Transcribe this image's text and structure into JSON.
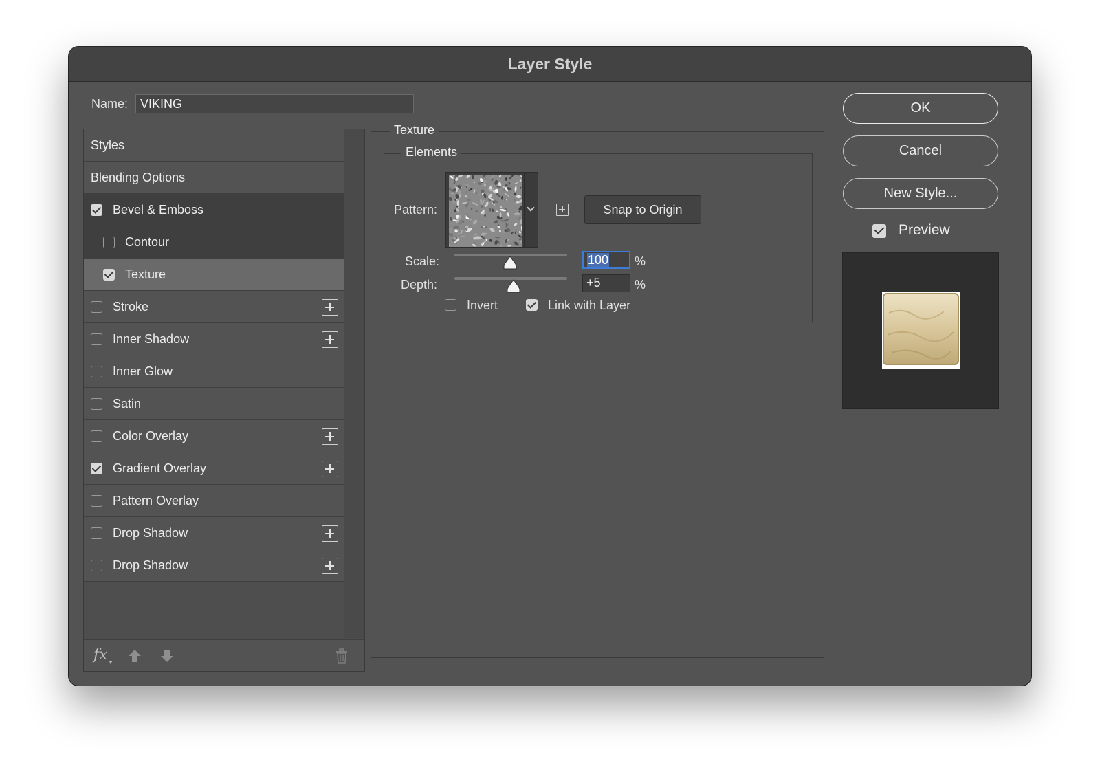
{
  "dialog": {
    "title": "Layer Style"
  },
  "name_field": {
    "label": "Name:",
    "value": "VIKING"
  },
  "styles_list": [
    {
      "label": "Styles",
      "type": "header"
    },
    {
      "label": "Blending Options",
      "type": "header"
    },
    {
      "label": "Bevel & Emboss",
      "checked": true,
      "state": "active-parent"
    },
    {
      "label": "Contour",
      "checked": false,
      "sub": true
    },
    {
      "label": "Texture",
      "checked": true,
      "sub": true,
      "selected": true
    },
    {
      "label": "Stroke",
      "checked": false,
      "add": true
    },
    {
      "label": "Inner Shadow",
      "checked": false,
      "add": true
    },
    {
      "label": "Inner Glow",
      "checked": false
    },
    {
      "label": "Satin",
      "checked": false
    },
    {
      "label": "Color Overlay",
      "checked": false,
      "add": true
    },
    {
      "label": "Gradient Overlay",
      "checked": true,
      "add": true
    },
    {
      "label": "Pattern Overlay",
      "checked": false
    },
    {
      "label": "Drop Shadow",
      "checked": false,
      "add": true
    },
    {
      "label": "Drop Shadow",
      "checked": false,
      "add": true
    }
  ],
  "list_footer": {
    "fx_label": "fx",
    "icons": [
      "move-up-icon",
      "move-down-icon",
      "trash-icon"
    ]
  },
  "texture_panel": {
    "section_title": "Texture",
    "group_title": "Elements",
    "pattern_label": "Pattern:",
    "snap_button": "Snap to Origin",
    "scale": {
      "label": "Scale:",
      "value": "100",
      "unit": "%",
      "slider_fraction": 0.5
    },
    "depth": {
      "label": "Depth:",
      "value": "+5",
      "unit": "%",
      "slider_fraction": 0.53
    },
    "invert": {
      "label": "Invert",
      "checked": false
    },
    "link_with_layer": {
      "label": "Link with Layer",
      "checked": true
    }
  },
  "buttons": {
    "ok": "OK",
    "cancel": "Cancel",
    "new_style": "New Style..."
  },
  "preview": {
    "label": "Preview",
    "checked": true
  },
  "colors": {
    "dialog_bg": "#535353",
    "titlebar_bg": "#434343",
    "focus": "#3d7bd9"
  }
}
